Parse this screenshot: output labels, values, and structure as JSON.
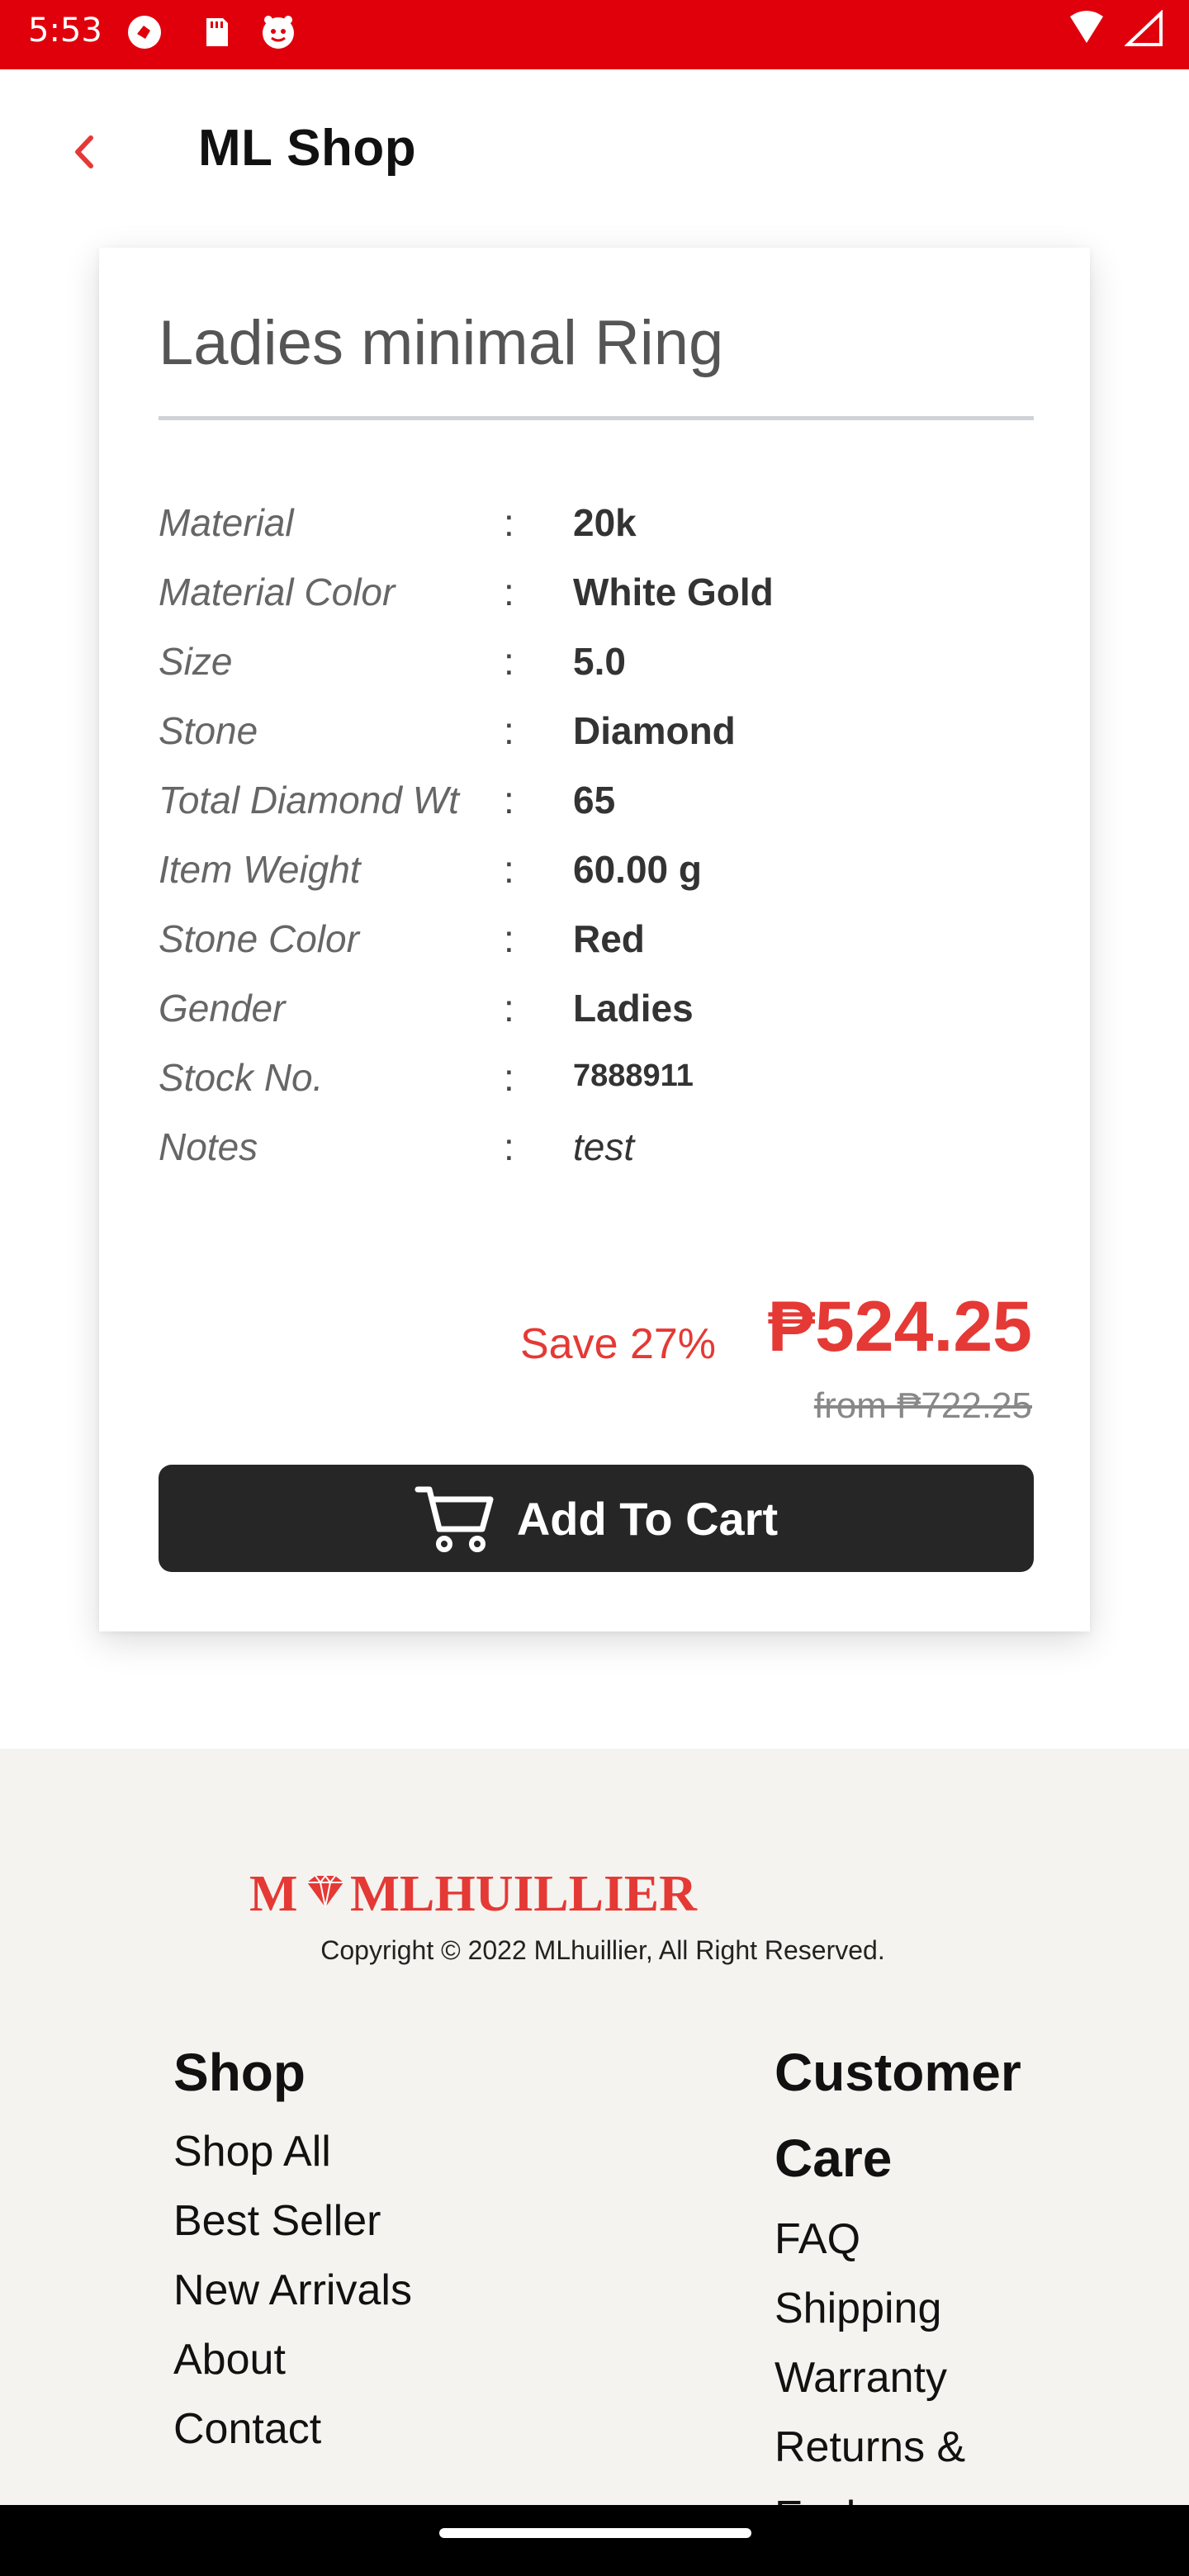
{
  "status_bar": {
    "time": "5:53"
  },
  "app_bar": {
    "title": "ML Shop"
  },
  "product": {
    "name": "Ladies minimal Ring",
    "specs": [
      {
        "label": "Material",
        "value": "20k"
      },
      {
        "label": "Material Color",
        "value": "White Gold"
      },
      {
        "label": "Size",
        "value": "5.0"
      },
      {
        "label": "Stone",
        "value": "Diamond"
      },
      {
        "label": "Total Diamond Wt",
        "value": "65"
      },
      {
        "label": "Item Weight",
        "value": "60.00 g"
      },
      {
        "label": "Stone Color",
        "value": "Red"
      },
      {
        "label": "Gender",
        "value": "Ladies"
      },
      {
        "label": "Stock No.",
        "value": "7888911"
      },
      {
        "label": "Notes",
        "value": "test"
      }
    ],
    "colon": ":",
    "save_label": "Save 27%",
    "price": "₱524.25",
    "original_price": "from ₱722.25",
    "add_to_cart_label": "Add To Cart"
  },
  "footer": {
    "brand": "MLHUILLIER",
    "copyright": "Copyright © 2022 MLhuillier, All Right Reserved.",
    "shop": {
      "heading": "Shop",
      "links": [
        "Shop All",
        "Best Seller",
        "New Arrivals",
        "About",
        "Contact"
      ]
    },
    "customer_care": {
      "heading_line1": "Customer",
      "heading_line2": "Care",
      "links": [
        "FAQ",
        "Shipping",
        "Warranty",
        "Returns &",
        "Exchange"
      ]
    }
  },
  "colors": {
    "status_bar": "#e0000c",
    "accent_red": "#e53935",
    "button_dark": "#262626",
    "footer_bg": "#f4f3ef"
  }
}
